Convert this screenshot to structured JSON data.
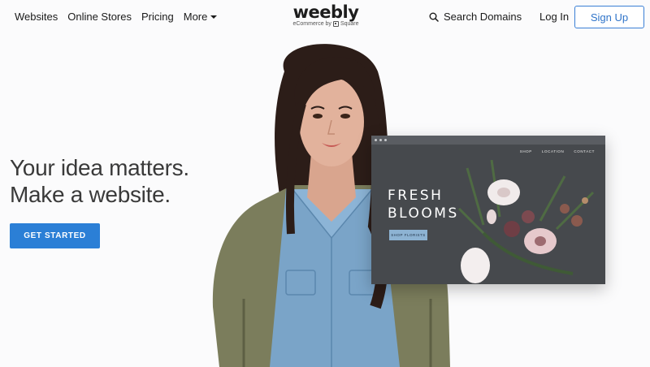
{
  "header": {
    "nav": [
      {
        "label": "Websites"
      },
      {
        "label": "Online Stores"
      },
      {
        "label": "Pricing"
      },
      {
        "label": "More"
      }
    ],
    "logo": {
      "wordmark": "weebly",
      "tagline": "eCommerce by",
      "partner": "Square"
    },
    "search_label": "Search Domains",
    "login_label": "Log In",
    "signup_label": "Sign Up"
  },
  "hero": {
    "headline_line1": "Your idea matters.",
    "headline_line2": "Make a website.",
    "cta_label": "GET STARTED"
  },
  "preview": {
    "nav": [
      "SHOP",
      "LOCATION",
      "CONTACT"
    ],
    "title_line1": "FRESH",
    "title_line2": "BLOOMS",
    "button_label": "SHOP FLORISTS"
  },
  "colors": {
    "accent": "#2b7fd6",
    "signup_border": "#3a7fd5",
    "background": "#fbfbfc",
    "preview_bg": "#46494d"
  }
}
